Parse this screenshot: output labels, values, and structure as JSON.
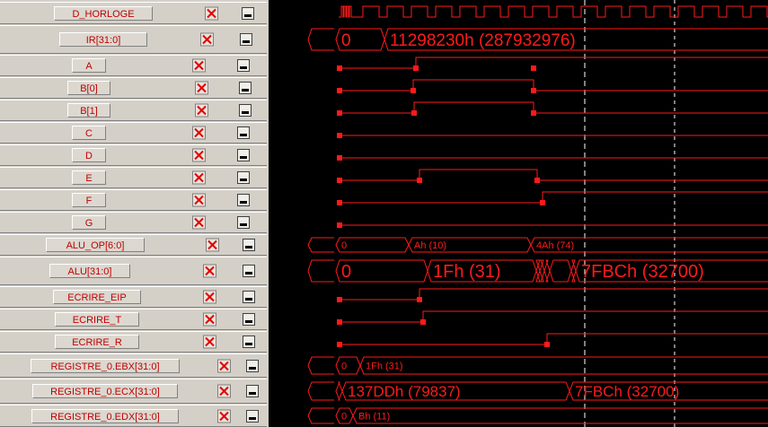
{
  "signals": [
    {
      "name": "D_HORLOGE",
      "kind": "clock"
    },
    {
      "name": "IR[31:0]",
      "kind": "bus",
      "values": [
        "0",
        "11298230h (287932976)"
      ]
    },
    {
      "name": "A",
      "kind": "bit"
    },
    {
      "name": "B[0]",
      "kind": "bit"
    },
    {
      "name": "B[1]",
      "kind": "bit"
    },
    {
      "name": "C",
      "kind": "bit"
    },
    {
      "name": "D",
      "kind": "bit"
    },
    {
      "name": "E",
      "kind": "bit"
    },
    {
      "name": "F",
      "kind": "bit"
    },
    {
      "name": "G",
      "kind": "bit"
    },
    {
      "name": "ALU_OP[6:0]",
      "kind": "bus",
      "values": [
        "0",
        "Ah (10)",
        "4Ah (74)"
      ]
    },
    {
      "name": "ALU[31:0]",
      "kind": "bus",
      "values": [
        "0",
        "1Fh (31)",
        "7FBCh (32700)"
      ]
    },
    {
      "name": "ECRIRE_EIP",
      "kind": "bit"
    },
    {
      "name": "ECRIRE_T",
      "kind": "bit"
    },
    {
      "name": "ECRIRE_R",
      "kind": "bit"
    },
    {
      "name": "REGISTRE_0.EBX[31:0]",
      "kind": "bus",
      "values": [
        "0",
        "1Fh (31)"
      ]
    },
    {
      "name": "REGISTRE_0.ECX[31:0]",
      "kind": "bus",
      "values": [
        "137DDh (79837)",
        "7FBCh (32700)"
      ]
    },
    {
      "name": "REGISTRE_0.EDX[31:0]",
      "kind": "bus",
      "values": [
        "0",
        "Bh (11)"
      ]
    }
  ],
  "icons": {
    "delete": "delete-x-icon",
    "visibility": "minimize-icon"
  },
  "colors": {
    "wave": "#ff1a1a",
    "panel": "#d4d0c8",
    "label": "#c00000",
    "background": "#000000"
  }
}
